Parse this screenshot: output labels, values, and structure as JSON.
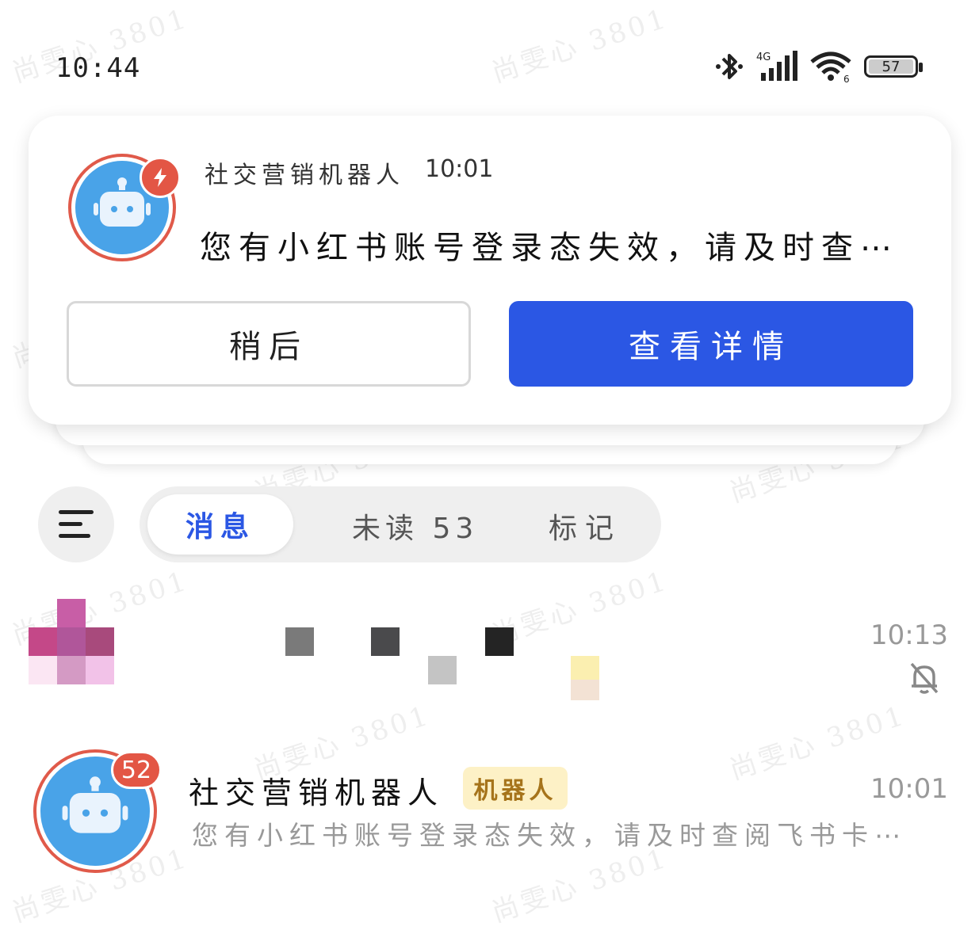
{
  "watermark": "尚雯心 3801",
  "status_bar": {
    "time": "10:44",
    "network": "4G",
    "wifi_band": "6",
    "battery": "57"
  },
  "notification": {
    "sender": "社交营销机器人",
    "time": "10:01",
    "body": "您有小红书账号登录态失效，请及时查⋯",
    "later_label": "稍后",
    "view_label": "查看详情",
    "icons": [
      "robot-icon",
      "bolt-icon"
    ],
    "accent_color": "#2b57e4",
    "badge_color": "#e35645"
  },
  "tabs": {
    "messages": "消息",
    "unread": "未读 53",
    "marked": "标记"
  },
  "chats": [
    {
      "time": "10:13",
      "muted": true
    },
    {
      "name": "社交营销机器人",
      "tag": "机器人",
      "badge": "52",
      "time": "10:01",
      "preview": "您有小红书账号登录态失效，请及时查阅飞书卡⋯"
    }
  ]
}
